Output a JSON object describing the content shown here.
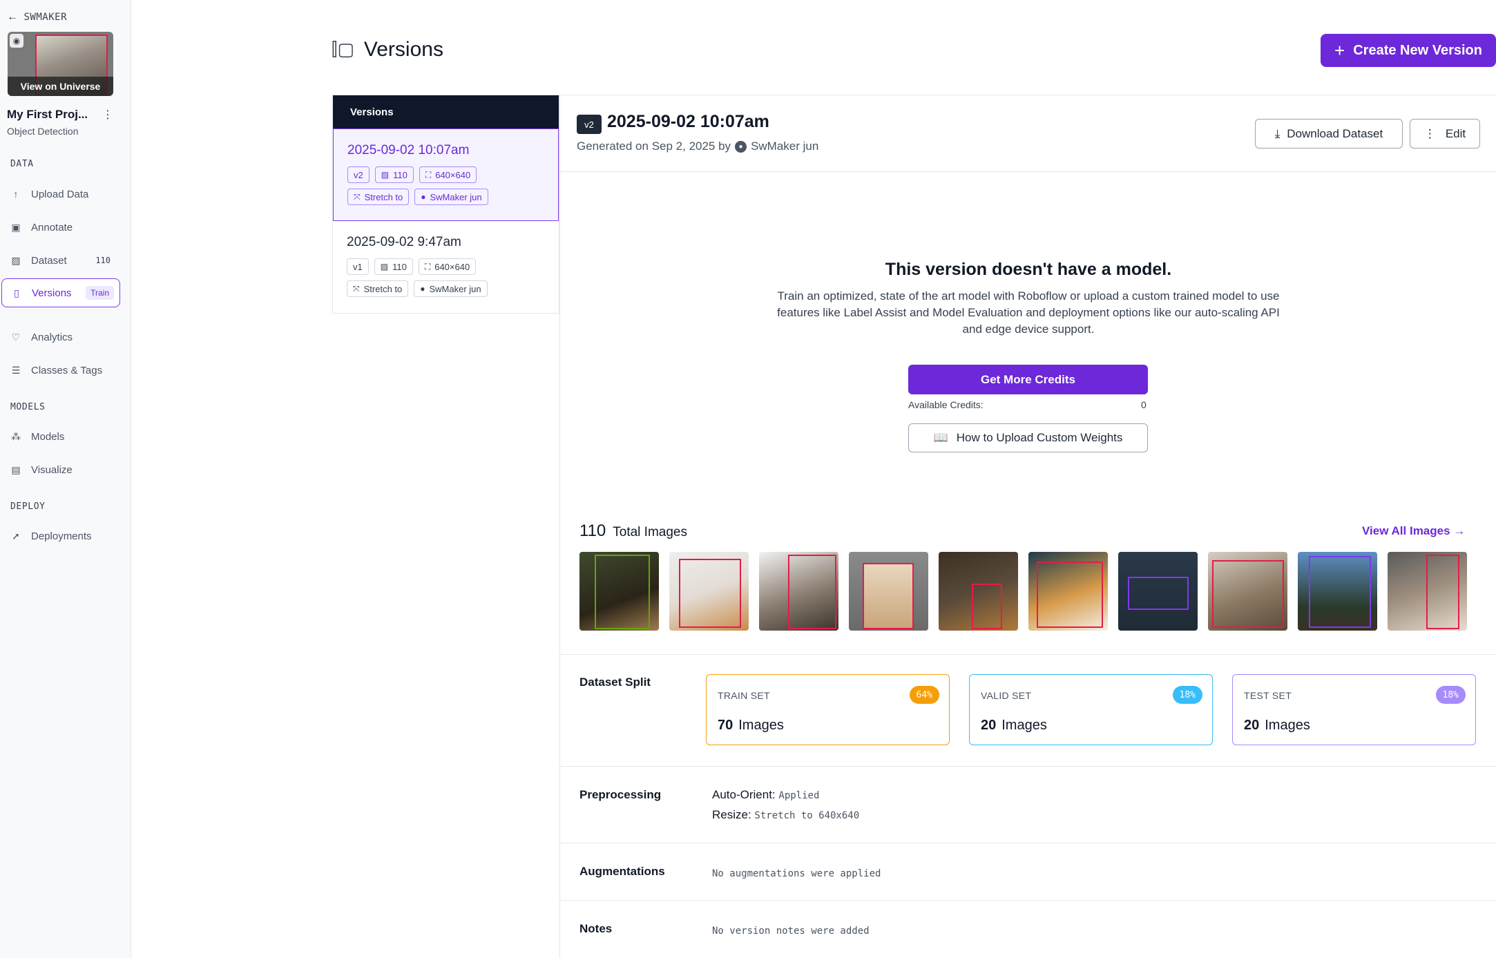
{
  "workspace": "SWMAKER",
  "project": {
    "name": "My First Proj...",
    "type": "Object Detection",
    "view_on_universe": "View on Universe"
  },
  "sidebar": {
    "sections": {
      "data": "DATA",
      "models": "MODELS",
      "deploy": "DEPLOY"
    },
    "items": [
      {
        "label": "Upload Data",
        "icon": "upload-icon"
      },
      {
        "label": "Annotate",
        "icon": "annotate-icon"
      },
      {
        "label": "Dataset",
        "icon": "image-icon",
        "count": "110"
      },
      {
        "label": "Versions",
        "icon": "versions-icon",
        "badge": "Train"
      },
      {
        "label": "Analytics",
        "icon": "analytics-icon"
      },
      {
        "label": "Classes & Tags",
        "icon": "list-icon"
      },
      {
        "label": "Models",
        "icon": "models-icon"
      },
      {
        "label": "Visualize",
        "icon": "chart-icon"
      },
      {
        "label": "Deployments",
        "icon": "rocket-icon"
      }
    ]
  },
  "header": {
    "title": "Versions",
    "create_button": "Create New Version"
  },
  "versions_list": {
    "heading": "Versions",
    "items": [
      {
        "date": "2025-09-02 10:07am",
        "version": "v2",
        "images": "110",
        "size": "640×640",
        "preprocess": "Stretch to",
        "author": "SwMaker jun",
        "selected": true
      },
      {
        "date": "2025-09-02 9:47am",
        "version": "v1",
        "images": "110",
        "size": "640×640",
        "preprocess": "Stretch to",
        "author": "SwMaker jun",
        "selected": false
      }
    ]
  },
  "detail": {
    "version_tag": "v2",
    "title": "2025-09-02 10:07am",
    "generated_prefix": "Generated on Sep 2, 2025 by",
    "author": "SwMaker jun",
    "download_button": "Download Dataset",
    "edit_button": "Edit",
    "no_model_title": "This version doesn't have a model.",
    "no_model_desc": "Train an optimized, state of the art model with Roboflow or upload a custom trained model to use features like Label Assist and Model Evaluation and deployment options like our auto-scaling API and edge device support.",
    "credits_button": "Get More Credits",
    "credits_label": "Available Credits:",
    "credits_value": "0",
    "upload_weights_button": "How to Upload Custom Weights",
    "total_images_count": "110",
    "total_images_label": "Total Images",
    "view_all": "View All Images",
    "split_label": "Dataset Split",
    "splits": [
      {
        "name": "TRAIN SET",
        "pct": "64%",
        "count": "70",
        "unit": "Images",
        "color": "#f59e0b"
      },
      {
        "name": "VALID SET",
        "pct": "18%",
        "count": "20",
        "unit": "Images",
        "color": "#38bdf8"
      },
      {
        "name": "TEST SET",
        "pct": "18%",
        "count": "20",
        "unit": "Images",
        "color": "#a78bfa"
      }
    ],
    "preprocessing_label": "Preprocessing",
    "preprocessing": [
      {
        "key": "Auto-Orient:",
        "value": "Applied"
      },
      {
        "key": "Resize:",
        "value": "Stretch to 640x640"
      }
    ],
    "augmentations_label": "Augmentations",
    "augmentations_value": "No augmentations were applied",
    "notes_label": "Notes",
    "notes_value": "No version notes were added"
  },
  "colors": {
    "accent": "#6d28d9",
    "nav_dark": "#0f172a"
  }
}
